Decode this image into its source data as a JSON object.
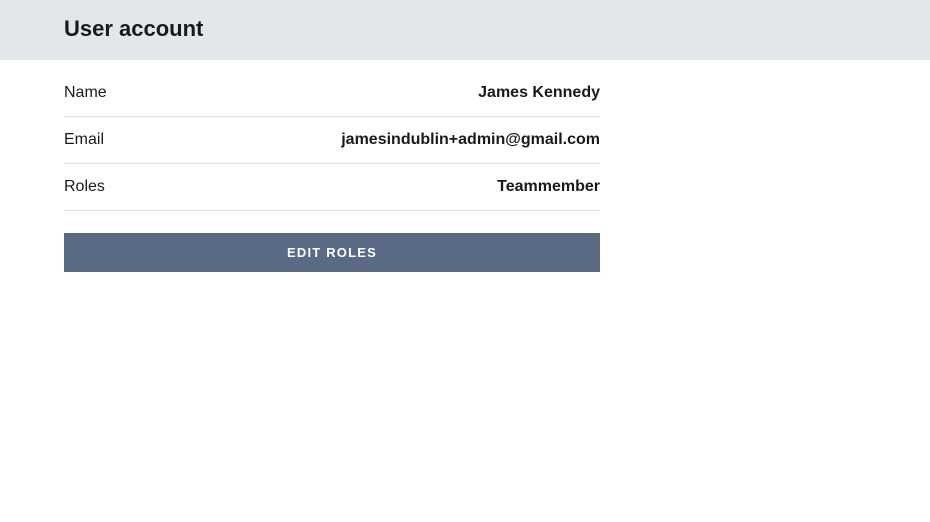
{
  "header": {
    "title": "User account"
  },
  "fields": {
    "name": {
      "label": "Name",
      "value": "James Kennedy"
    },
    "email": {
      "label": "Email",
      "value": "jamesindublin+admin@gmail.com"
    },
    "roles": {
      "label": "Roles",
      "value": "Teammember"
    }
  },
  "actions": {
    "edit_roles": "EDIT ROLES"
  },
  "colors": {
    "header_bg": "#e3e7ec",
    "button_bg": "#5a6a85",
    "text": "#1a1a1a",
    "divider": "#e0e0e0"
  }
}
